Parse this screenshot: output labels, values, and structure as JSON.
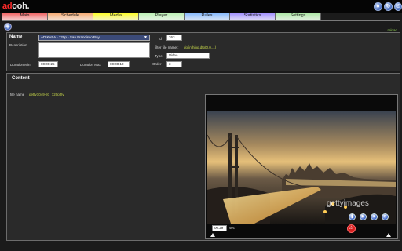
{
  "app": {
    "logo_ad": "ad",
    "logo_ooh": "ooh."
  },
  "nav": {
    "tabs": [
      {
        "label": "Main",
        "color": "#f05a5a"
      },
      {
        "label": "Schedule",
        "color": "#f6a66a"
      },
      {
        "label": "Media",
        "color": "#ffff1a"
      },
      {
        "label": "Player",
        "color": "#b8f0b0"
      },
      {
        "label": "Rules",
        "color": "#7fb6ff"
      },
      {
        "label": "Statistics",
        "color": "#9c88ff"
      },
      {
        "label": "Settings",
        "color": "#a8e6a0"
      }
    ]
  },
  "header_icons": [
    "profile-icon",
    "refresh-icon",
    "logout-icon"
  ],
  "status": "reload",
  "properties": {
    "name_label": "Name",
    "name_value": "AD KVAA - 720p - San Francisco Bay",
    "description_label": "Description",
    "description_value": "",
    "duration_min_label": "Duration Min",
    "duration_min_value": "00:00:25",
    "duration_max_label": "Duration Max",
    "duration_max_value": "00:00:10",
    "id_label": "Id",
    "id_value": "263",
    "filter_label": "filter file name :",
    "filter_value": "dofinthing.dtp(0,0..,,)",
    "type_label": "Type",
    "type_value": "Video",
    "order_label": "Order",
    "order_value": "3"
  },
  "content": {
    "title": "Content",
    "file_name_label": "file name",
    "file_name_value": "getty1049-91_720p.flv"
  },
  "video": {
    "watermark": "gettyimages",
    "time": "00:29",
    "time_unit": "sec",
    "progress": 0.02,
    "volume": 0.8
  }
}
